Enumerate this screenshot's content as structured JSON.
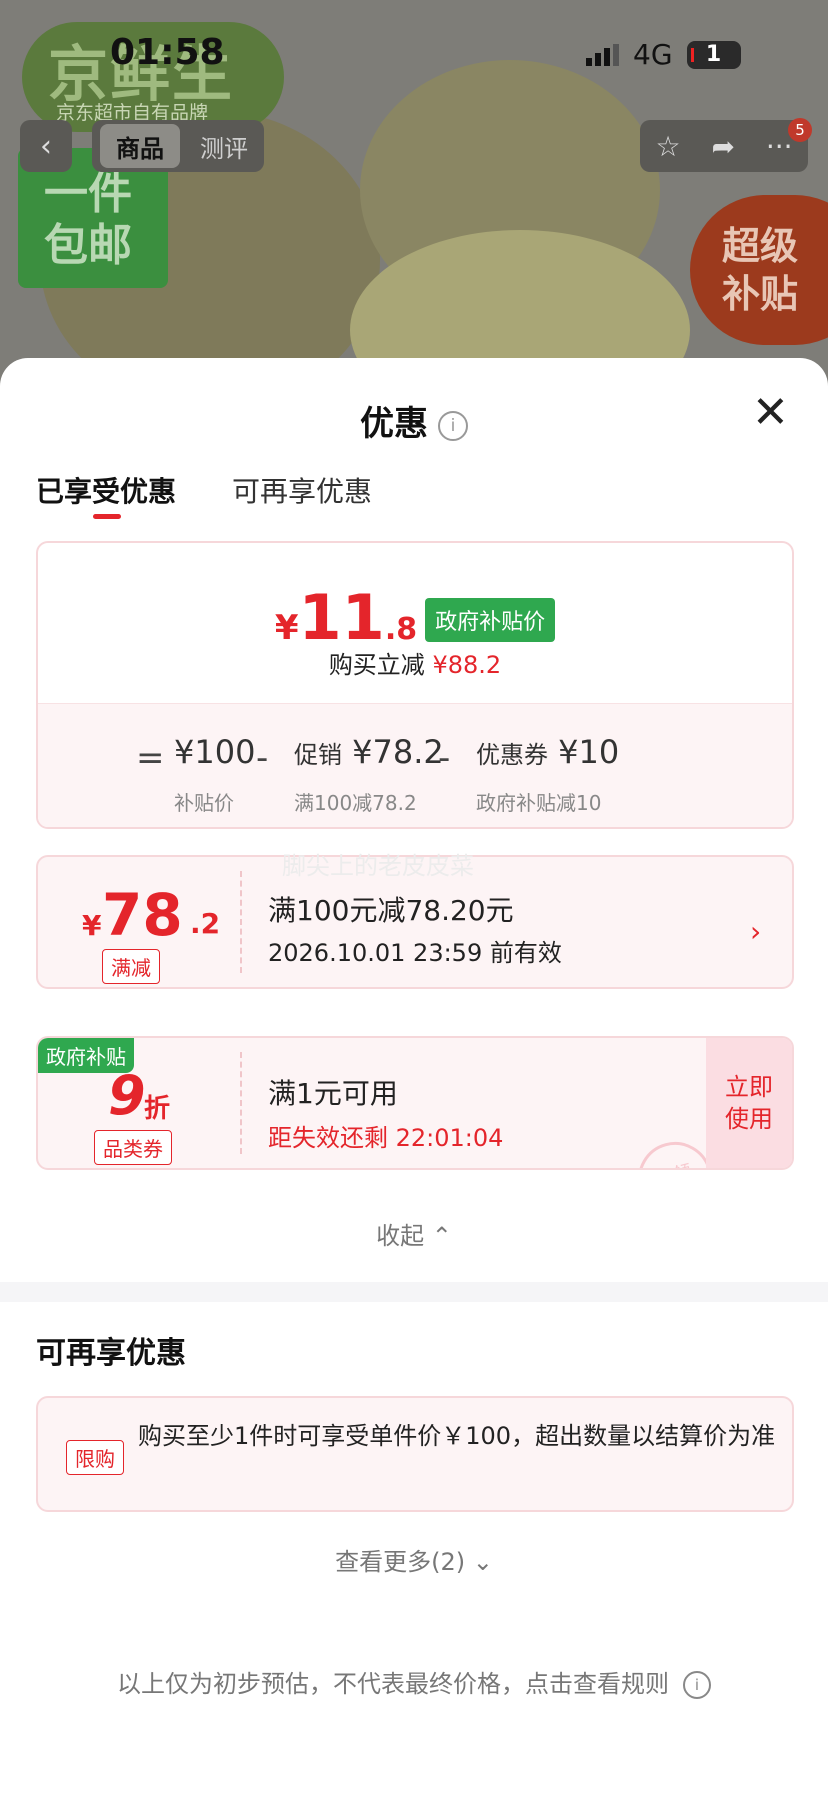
{
  "status_bar": {
    "time": "01:58",
    "network": "4G",
    "battery": "1"
  },
  "background": {
    "brand_big": "京鲜生",
    "brand_small": "京东超市自有品牌",
    "free_shipping": "一件包邮",
    "subsidy": "超级补贴"
  },
  "top_nav": {
    "tabs": [
      {
        "label": "商品"
      },
      {
        "label": "测评"
      }
    ],
    "badge_count": "5"
  },
  "sheet": {
    "title": "优惠",
    "tabs": [
      {
        "label": "已享受优惠"
      },
      {
        "label": "可再享优惠"
      }
    ]
  },
  "summary": {
    "currency": "¥",
    "price_int": "11",
    "price_dec": ".8",
    "badge": "政府补贴价",
    "reduce_label": "购买立减",
    "reduce_amount": "¥88.2",
    "formula": {
      "equals": "=",
      "base_value": "¥100",
      "base_sub": "补贴价",
      "minus": "-",
      "promo_label": "促销",
      "promo_value": "¥78.2",
      "promo_sub": "满100减78.2",
      "coupon_label": "优惠券",
      "coupon_value": "¥10",
      "coupon_sub": "政府补贴减10"
    }
  },
  "coupon1": {
    "yen": "¥",
    "value": "78",
    "dec": ".2",
    "tag": "满减",
    "title": "满100元减78.20元",
    "valid": "2026.10.01 23:59 前有效",
    "arrow": "›"
  },
  "watermark": "脚尖上的老皮皮菜",
  "coupon2": {
    "badge": "政府补贴",
    "discount": "9",
    "unit": "折",
    "tag": "品类券",
    "title": "满1元可用",
    "countdown": "距失效还剩 22:01:04",
    "action": "立即使用",
    "stamp": "已领"
  },
  "collapse_label": "收起",
  "section2_title": "可再享优惠",
  "limit": {
    "tag": "限购",
    "text": "购买至少1件时可享受单件价￥100，超出数量以结算价为准"
  },
  "more_label": "查看更多(2)",
  "footer": "以上仅为初步预估，不代表最终价格，点击查看规则",
  "icons": [
    "back-icon",
    "star-icon",
    "share-icon",
    "more-icon",
    "info-icon",
    "close-icon",
    "chevron-right-icon",
    "chevron-up-icon",
    "chevron-down-icon"
  ]
}
